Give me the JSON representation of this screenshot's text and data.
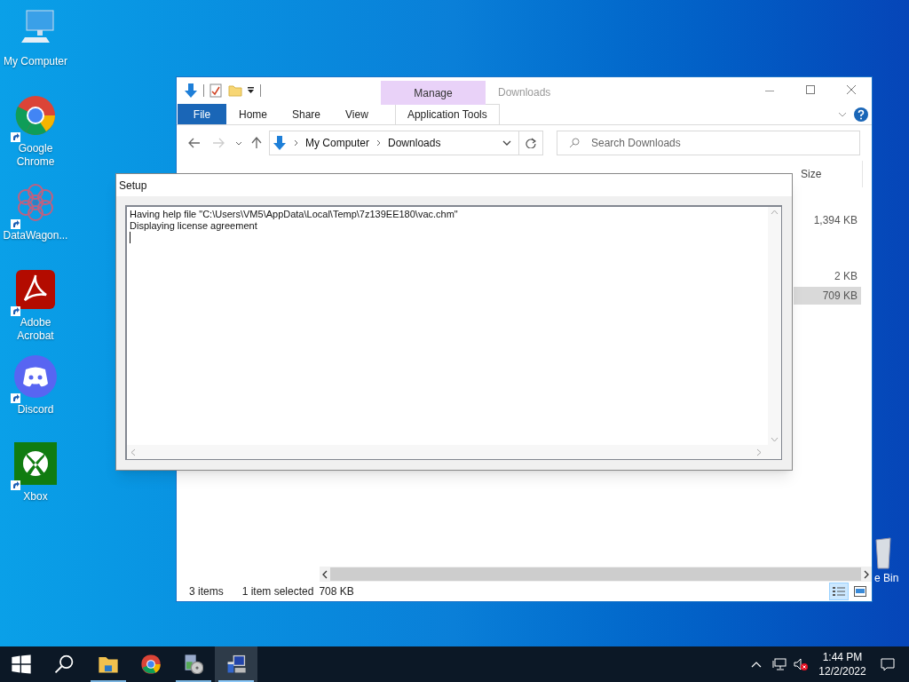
{
  "desktop_icons": [
    {
      "label": "My Computer",
      "kind": "computer",
      "shortcut": false
    },
    {
      "label": "Google Chrome",
      "kind": "chrome",
      "shortcut": true
    },
    {
      "label": "DataWagon...",
      "kind": "datawagon",
      "shortcut": true
    },
    {
      "label": "Adobe Acrobat",
      "kind": "acrobat",
      "shortcut": true
    },
    {
      "label": "Discord",
      "kind": "discord",
      "shortcut": true
    },
    {
      "label": "Xbox",
      "kind": "xbox",
      "shortcut": true
    }
  ],
  "recycle_bin": {
    "label": "e Bin"
  },
  "explorer": {
    "title": "Downloads",
    "context_group": "Manage",
    "ribbon_tabs": [
      {
        "label": "File",
        "kind": "file"
      },
      {
        "label": "Home",
        "kind": "plain"
      },
      {
        "label": "Share",
        "kind": "plain"
      },
      {
        "label": "View",
        "kind": "plain"
      },
      {
        "label": "Application Tools",
        "kind": "context"
      }
    ],
    "breadcrumb": [
      "My Computer",
      "Downloads"
    ],
    "search": {
      "placeholder": "Search Downloads"
    },
    "columns": [
      "Size"
    ],
    "rows": [
      {
        "size": "1,394 KB",
        "selected": false
      },
      {
        "size": "2 KB",
        "selected": false
      },
      {
        "size": "709 KB",
        "selected": true
      }
    ],
    "status": {
      "count": "3 items",
      "selection": "1 item selected",
      "size": "708 KB"
    }
  },
  "setup": {
    "title": "Setup",
    "lines": [
      "Having help file \"C:\\Users\\VM5\\AppData\\Local\\Temp\\7z139EE180\\vac.chm\"",
      "Displaying license agreement"
    ]
  },
  "taskbar": {
    "items": [
      {
        "kind": "start",
        "running": false,
        "active": false
      },
      {
        "kind": "search",
        "running": false,
        "active": false
      },
      {
        "kind": "explorer",
        "running": true,
        "active": false
      },
      {
        "kind": "chrome",
        "running": false,
        "active": false
      },
      {
        "kind": "installer",
        "running": true,
        "active": false
      },
      {
        "kind": "setup",
        "running": true,
        "active": true
      }
    ],
    "time": "1:44 PM",
    "date": "12/2/2022"
  }
}
